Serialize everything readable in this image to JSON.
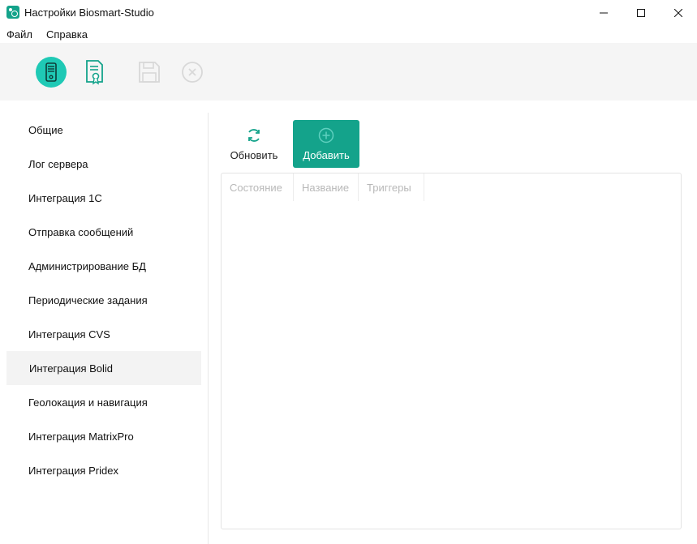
{
  "window": {
    "title": "Настройки Biosmart-Studio"
  },
  "menu": {
    "items": [
      "Файл",
      "Справка"
    ]
  },
  "toolbar": {
    "icons": [
      "server-icon",
      "certificate-document-icon",
      "save-icon",
      "close-circle-icon"
    ]
  },
  "sidebar": {
    "items": [
      {
        "label": "Общие"
      },
      {
        "label": "Лог сервера"
      },
      {
        "label": "Интеграция 1С"
      },
      {
        "label": "Отправка сообщений"
      },
      {
        "label": "Администрирование БД"
      },
      {
        "label": "Периодические задания"
      },
      {
        "label": "Интеграция CVS"
      },
      {
        "label": "Интеграция Bolid"
      },
      {
        "label": "Геолокация и навигация"
      },
      {
        "label": "Интеграция MatrixPro"
      },
      {
        "label": "Интеграция Pridex"
      }
    ],
    "selected": "Интеграция Bolid"
  },
  "actions": {
    "refresh_label": "Обновить",
    "add_label": "Добавить"
  },
  "table": {
    "columns": [
      "Состояние",
      "Название",
      "Триггеры"
    ],
    "rows": []
  },
  "colors": {
    "accent": "#14a38b",
    "toolbar_bg": "#f5f5f5",
    "selected_bg": "#f3f3f3"
  }
}
